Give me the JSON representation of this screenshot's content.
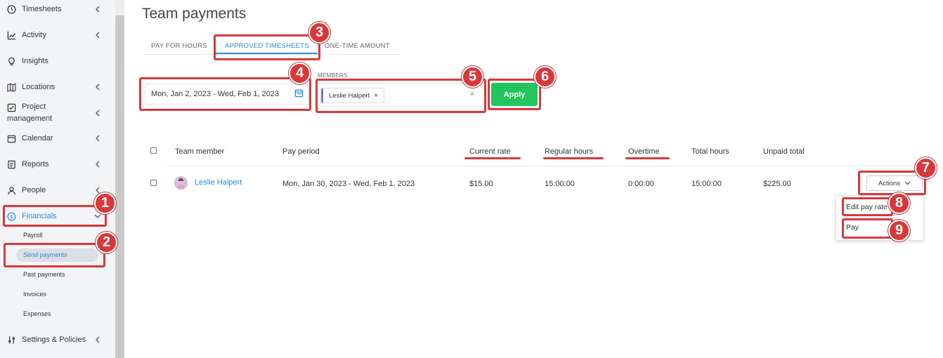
{
  "sidebar": {
    "items": [
      {
        "label": "Timesheets",
        "icon": "clock-icon"
      },
      {
        "label": "Activity",
        "icon": "chart-line-icon"
      },
      {
        "label": "Insights",
        "icon": "lightbulb-icon"
      },
      {
        "label": "Locations",
        "icon": "map-icon"
      },
      {
        "label": "Project",
        "label2": "management",
        "icon": "checkbox-icon"
      },
      {
        "label": "Calendar",
        "icon": "calendar-icon"
      },
      {
        "label": "Reports",
        "icon": "report-icon"
      },
      {
        "label": "People",
        "icon": "person-icon"
      },
      {
        "label": "Financials",
        "icon": "dollar-icon"
      },
      {
        "label": "Settings & Policies",
        "icon": "sliders-icon"
      }
    ],
    "financials_sub": [
      "Payroll",
      "Send payments",
      "Past payments",
      "Invoices",
      "Expenses"
    ],
    "active_color": "#2d8ad6"
  },
  "page": {
    "title": "Team payments"
  },
  "tabs": [
    {
      "label": "PAY FOR HOURS"
    },
    {
      "label": "APPROVED TIMESHEETS"
    },
    {
      "label": "ONE-TIME AMOUNT"
    }
  ],
  "filters": {
    "date_range": "Mon, Jan 2, 2023 - Wed, Feb 1, 2023",
    "members_label": "MEMBERS",
    "member_chip": "Leslie Halpert",
    "chip_remove": "×",
    "clear": "×",
    "apply_label": "Apply",
    "apply_color": "#22c55e"
  },
  "table": {
    "columns": [
      "Team member",
      "Pay period",
      "Current rate",
      "Regular hours",
      "Overtime",
      "Total hours",
      "Unpaid total"
    ],
    "rows": [
      {
        "member": "Leslie Halpert",
        "pay_period": "Mon, Jan 30, 2023 - Wed, Feb 1, 2023",
        "current_rate": "$15.00",
        "regular_hours": "15:00:00",
        "overtime": "0:00:00",
        "total_hours": "15:00:00",
        "unpaid_total": "$225.00"
      }
    ],
    "actions_label": "Actions"
  },
  "actions_menu": [
    "Edit pay rate",
    "Pay"
  ],
  "annotations": [
    "1",
    "2",
    "3",
    "4",
    "5",
    "6",
    "7",
    "8",
    "9"
  ],
  "annotation_color": "#d9383a"
}
